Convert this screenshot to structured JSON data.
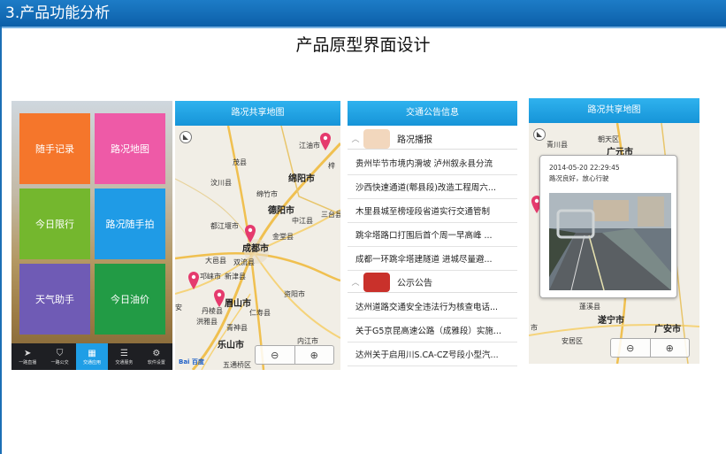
{
  "header": {
    "title": "3.产品功能分析"
  },
  "slide_title": "产品原型界面设计",
  "home": {
    "tiles": [
      {
        "label": "随手记录",
        "color": "#f5762b"
      },
      {
        "label": "路况地图",
        "color": "#ee5aa7"
      },
      {
        "label": "今日限行",
        "color": "#74b72e"
      },
      {
        "label": "路况随手拍",
        "color": "#1f9be6"
      },
      {
        "label": "天气助手",
        "color": "#6f5bb5"
      },
      {
        "label": "今日油价",
        "color": "#229b45"
      }
    ],
    "tabs": [
      {
        "label": "一路直播",
        "icon": "send-icon"
      },
      {
        "label": "一路公交",
        "icon": "bookmark-icon"
      },
      {
        "label": "交通应用",
        "icon": "grid-icon",
        "active": true
      },
      {
        "label": "交通服务",
        "icon": "menu-icon"
      },
      {
        "label": "软件设置",
        "icon": "gear-icon"
      }
    ]
  },
  "map1": {
    "title": "路况共享地图",
    "labels": [
      "江油市",
      "茂县",
      "绵阳市",
      "汶川县",
      "绵竹市",
      "德阳市",
      "中江县",
      "都江堰市",
      "成都市",
      "金堂县",
      "大邑县",
      "双流县",
      "邛崃市",
      "新津县",
      "资阳市",
      "眉山市",
      "丹棱县",
      "仁寿县",
      "洪雅县",
      "青神县",
      "乐山市",
      "内江市",
      "五通桥区",
      "三台县",
      "梓",
      "安"
    ],
    "baidu": "Bai 百度"
  },
  "notice": {
    "title": "交通公告信息",
    "section1": "路况播报",
    "items1": [
      "贵州毕节市境内滑坡  泸州叙永县分流",
      "沙西快速通道(郫县段)改造工程周六...",
      "木里县城至榜垭段省道实行交通管制",
      "跳伞塔路口打围后首个周一早高峰  ...",
      "成都一环跳伞塔建隧道  进城尽量避..."
    ],
    "section2": "公示公告",
    "items2": [
      "达州道路交通安全违法行为核查电话...",
      "关于G5京昆高速公路（成雅段）实施...",
      "达州关于启用川S.CA-CZ号段小型汽..."
    ]
  },
  "map2": {
    "title": "路况共享地图",
    "labels": [
      "青川县",
      "朝天区",
      "广元市",
      "遂宁市",
      "蓬溪县",
      "安居区",
      "广安市",
      "市"
    ],
    "popup_time": "2014-05-20 22:29:45",
    "popup_text": "路况良好，放心行驶"
  }
}
